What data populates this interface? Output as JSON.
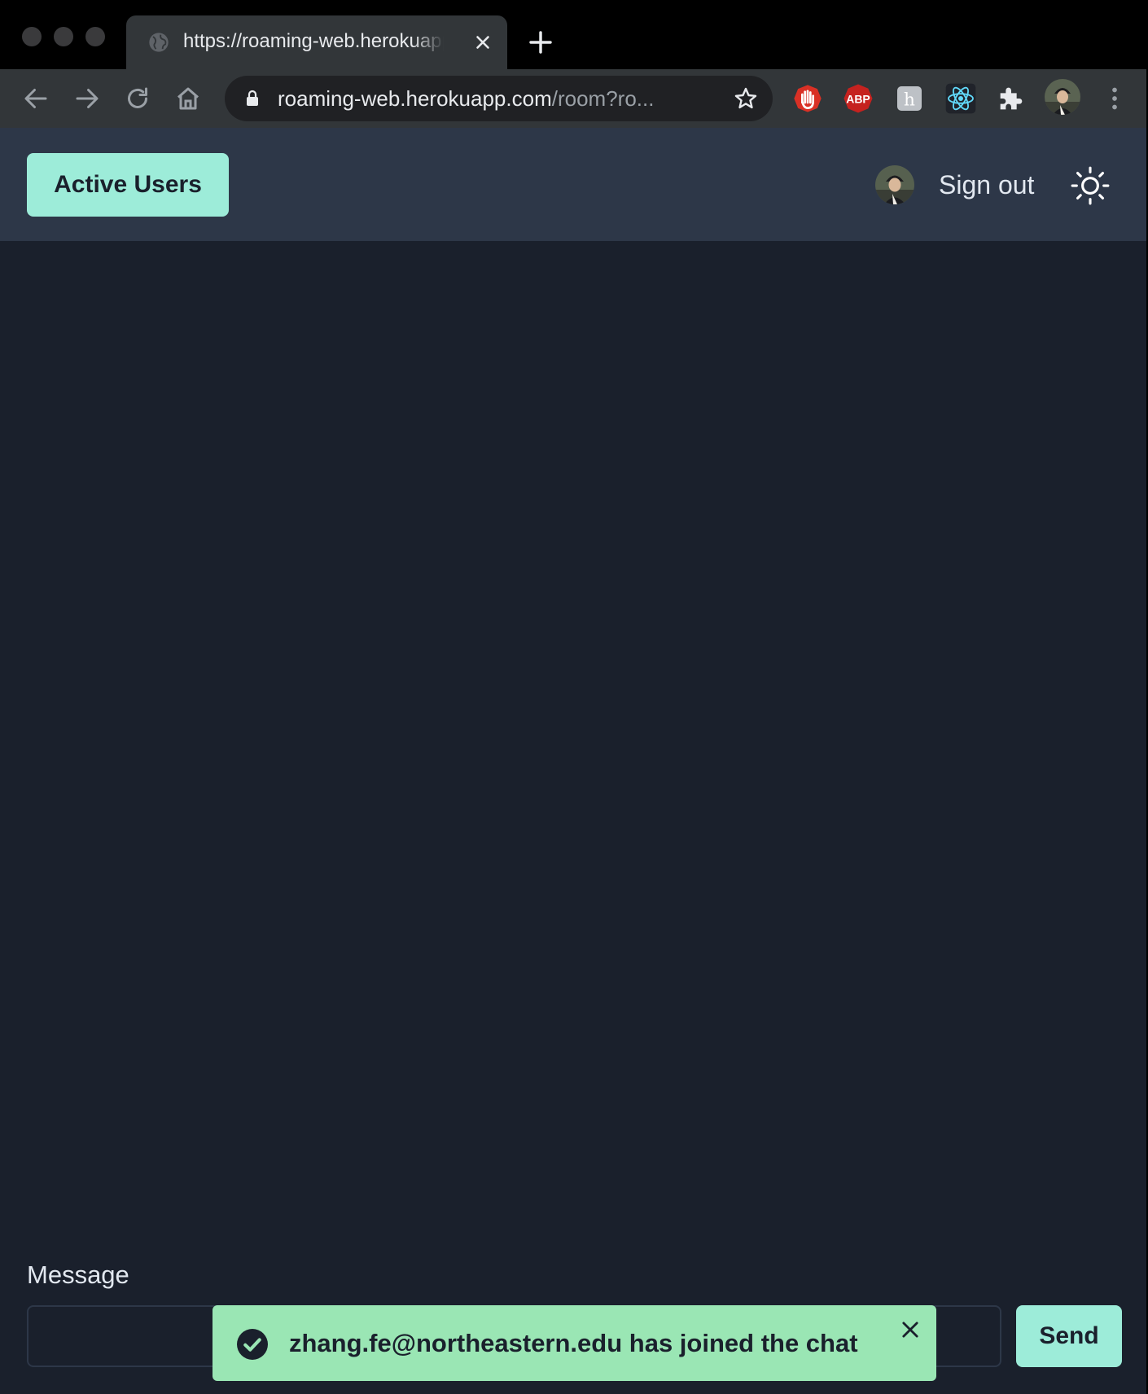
{
  "browser": {
    "tab": {
      "title": "https://roaming-web.herokuapp.com",
      "close_icon": "close-icon",
      "favicon": "globe-icon"
    },
    "new_tab_icon": "plus-icon",
    "toolbar": {
      "back_icon": "arrow-left-icon",
      "forward_icon": "arrow-right-icon",
      "reload_icon": "reload-icon",
      "home_icon": "home-icon",
      "url_host": "roaming-web.herokuapp.com",
      "url_path": "/room?ro...",
      "bookmark_icon": "star-icon",
      "extensions": [
        "hand-stop-icon",
        "adblock-plus-icon",
        "h-extension-icon",
        "react-icon",
        "puzzle-icon"
      ],
      "menu_icon": "kebab-menu-icon"
    }
  },
  "header": {
    "active_users_label": "Active Users",
    "sign_out_label": "Sign out",
    "theme_icon": "sun-icon"
  },
  "composer": {
    "label": "Message",
    "input_value": "",
    "send_label": "Send"
  },
  "toast": {
    "message": "zhang.fe@northeastern.edu has joined the chat",
    "status": "success"
  },
  "colors": {
    "accent": "#9decd9",
    "header_bg": "#2d3748",
    "page_bg": "#1a202c",
    "toast_bg": "#9ae6b4"
  }
}
